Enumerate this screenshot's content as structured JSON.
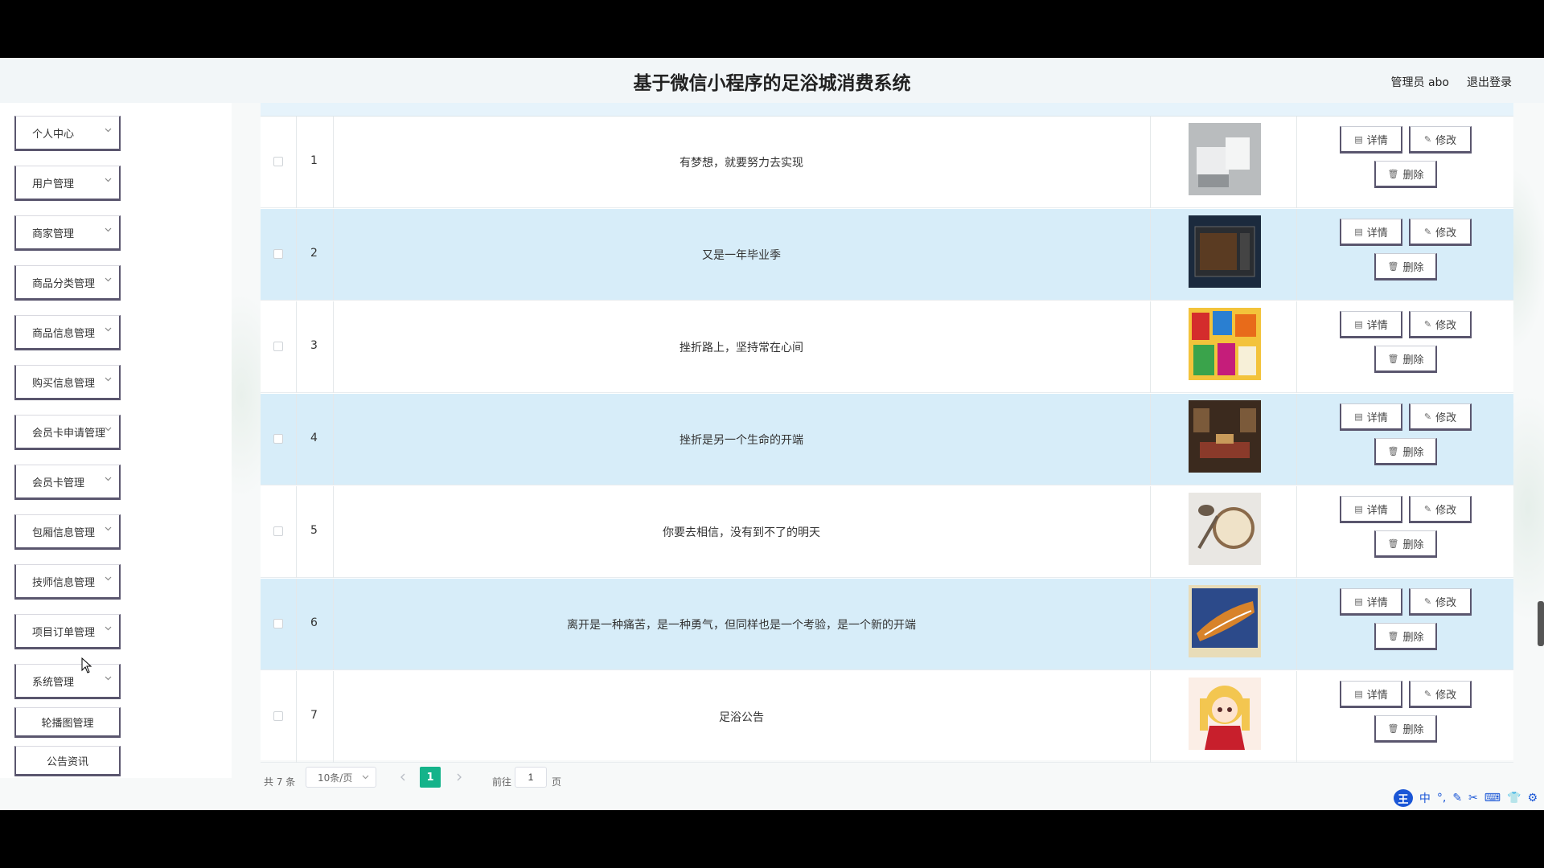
{
  "header": {
    "title": "基于微信小程序的足浴城消费系统",
    "user": "管理员 abo",
    "logout": "退出登录"
  },
  "sidebar": {
    "items": [
      {
        "label": "个人中心",
        "chevron": true
      },
      {
        "label": "用户管理",
        "chevron": true
      },
      {
        "label": "商家管理",
        "chevron": true
      },
      {
        "label": "商品分类管理",
        "chevron": true
      },
      {
        "label": "商品信息管理",
        "chevron": true
      },
      {
        "label": "购买信息管理",
        "chevron": true
      },
      {
        "label": "会员卡申请管理",
        "chevron": true
      },
      {
        "label": "会员卡管理",
        "chevron": true
      },
      {
        "label": "包厢信息管理",
        "chevron": true
      },
      {
        "label": "技师信息管理",
        "chevron": true
      },
      {
        "label": "项目订单管理",
        "chevron": true
      },
      {
        "label": "系统管理",
        "chevron": true
      },
      {
        "label": "轮播图管理",
        "chevron": false
      },
      {
        "label": "公告资讯",
        "chevron": false
      }
    ]
  },
  "table": {
    "actions": {
      "detail": "详情",
      "edit": "修改",
      "delete": "删除"
    },
    "rows": [
      {
        "index": "1",
        "title": "有梦想，就要努力去实现",
        "image": "white-sofa"
      },
      {
        "index": "2",
        "title": "又是一年毕业季",
        "image": "microwave-oven"
      },
      {
        "index": "3",
        "title": "挫折路上，坚持常在心间",
        "image": "snacks"
      },
      {
        "index": "4",
        "title": "挫折是另一个生命的开端",
        "image": "living-room"
      },
      {
        "index": "5",
        "title": "你要去相信，没有到不了的明天",
        "image": "oats-bowl"
      },
      {
        "index": "6",
        "title": "离开是一种痛苦，是一种勇气，但同样也是一个考验，是一个新的开端",
        "image": "shoe"
      },
      {
        "index": "7",
        "title": "足浴公告",
        "image": "anime-girl"
      }
    ]
  },
  "pagination": {
    "total": "共 7 条",
    "page_size": "10条/页",
    "current": "1",
    "goto_label": "前往",
    "goto_value": "1",
    "page_unit": "页"
  },
  "ime": {
    "logo": "王",
    "mode": "中"
  }
}
